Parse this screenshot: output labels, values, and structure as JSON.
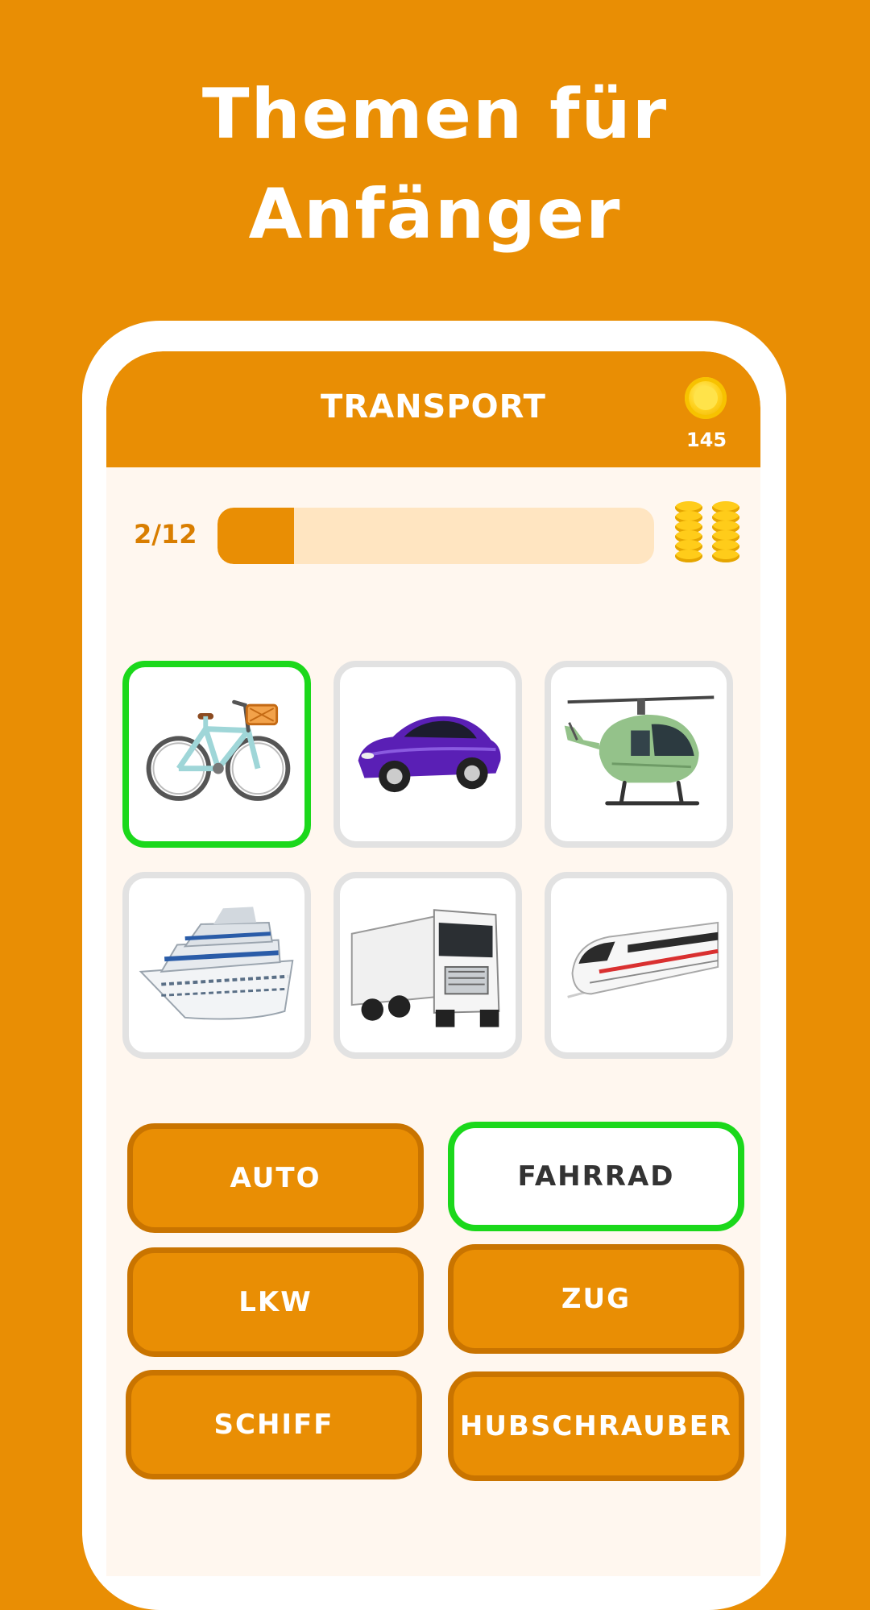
{
  "headline": {
    "line1": "Themen für",
    "line2": "Anfänger"
  },
  "topbar": {
    "title": "TRANSPORT",
    "coins": "145",
    "coin_icon": "coin-icon"
  },
  "progress": {
    "label": "2/12",
    "current": 2,
    "total": 12,
    "reward_icon": "coin-stack-icon"
  },
  "images": [
    {
      "name": "bicycle",
      "selected": true
    },
    {
      "name": "sports-car",
      "selected": false
    },
    {
      "name": "helicopter",
      "selected": false
    },
    {
      "name": "cruise-ship",
      "selected": false
    },
    {
      "name": "truck",
      "selected": false
    },
    {
      "name": "high-speed-train",
      "selected": false
    }
  ],
  "answers": [
    {
      "label": "AUTO",
      "selected": false
    },
    {
      "label": "FAHRRAD",
      "selected": true
    },
    {
      "label": "LKW",
      "selected": false
    },
    {
      "label": "ZUG",
      "selected": false
    },
    {
      "label": "SCHIFF",
      "selected": false
    },
    {
      "label": "HUBSCHRAUBER",
      "selected": false
    }
  ],
  "colors": {
    "background": "#E98E04",
    "screen": "#FFF7EF",
    "selected_border": "#1BD81B",
    "progress_track": "#FFE5C1"
  }
}
